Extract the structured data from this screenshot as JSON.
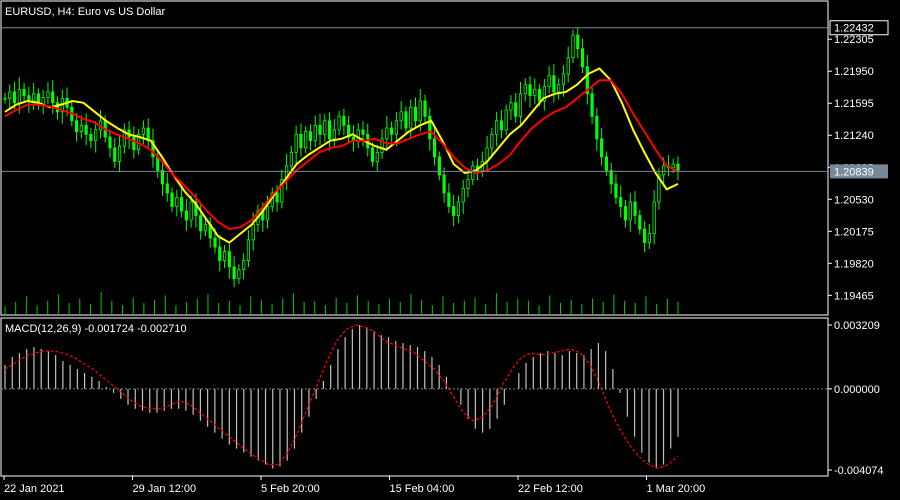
{
  "window": {
    "symbol_title": "EURUSD, H4:  Euro vs US Dollar",
    "macd_title": "MACD(12,26,9) -0.001724 -0.002710"
  },
  "colors": {
    "background": "#000000",
    "candle_bull": "#00ff00",
    "candle_bear": "#00ff00",
    "ma_fast": "#ffff00",
    "ma_slow": "#ff0000",
    "histogram": "#c0c0c0",
    "signal": "#ff0000",
    "grid": "#808080",
    "text": "#ffffff",
    "bid_line": "#778899"
  },
  "chart_data": [
    {
      "type": "candlestick",
      "title": "EURUSD, H4:  Euro vs US Dollar",
      "y_ticks": [
        "1.22305",
        "1.21950",
        "1.21595",
        "1.21240",
        "1.20885",
        "1.20530",
        "1.20175",
        "1.19820",
        "1.19465"
      ],
      "ylim": [
        1.1928,
        1.2254
      ],
      "last_price_label": "1.20839",
      "last_price": 1.20839,
      "top_price_label": "1.22432",
      "top_price": 1.22432,
      "x_ticks": [
        "22 Jan 2021",
        "29 Jan 12:00",
        "5 Feb 20:00",
        "15 Feb 04:00",
        "22 Feb 12:00",
        "1 Mar 20:00"
      ],
      "close_series": [
        1.2165,
        1.2172,
        1.216,
        1.2175,
        1.2168,
        1.2162,
        1.217,
        1.2158,
        1.2166,
        1.2172,
        1.216,
        1.215,
        1.2165,
        1.2155,
        1.214,
        1.2128,
        1.2135,
        1.2125,
        1.2118,
        1.213,
        1.214,
        1.2122,
        1.211,
        1.2095,
        1.2112,
        1.213,
        1.2122,
        1.2108,
        1.2125,
        1.2132,
        1.2118,
        1.21,
        1.2085,
        1.207,
        1.206,
        1.2045,
        1.2055,
        1.204,
        1.203,
        1.205,
        1.2035,
        1.2018,
        1.2025,
        1.201,
        1.2,
        1.1985,
        1.1995,
        1.1978,
        1.1965,
        1.1975,
        1.1985,
        1.2008,
        1.2025,
        1.204,
        1.203,
        1.2045,
        1.206,
        1.205,
        1.2075,
        1.209,
        1.2105,
        1.2125,
        1.211,
        1.2128,
        1.2118,
        1.2135,
        1.2125,
        1.214,
        1.212,
        1.213,
        1.2145,
        1.2135,
        1.2122,
        1.2118,
        1.213,
        1.2125,
        1.211,
        1.2095,
        1.2105,
        1.212,
        1.2132,
        1.2125,
        1.214,
        1.215,
        1.2132,
        1.2155,
        1.214,
        1.2162,
        1.2145,
        1.212,
        1.21,
        1.208,
        1.206,
        1.2045,
        1.2035,
        1.205,
        1.2065,
        1.2075,
        1.209,
        1.2085,
        1.2095,
        1.211,
        1.2125,
        1.214,
        1.213,
        1.2152,
        1.216,
        1.2145,
        1.217,
        1.218,
        1.2168,
        1.2175,
        1.2162,
        1.2178,
        1.219,
        1.2172,
        1.218,
        1.2192,
        1.221,
        1.2235,
        1.222,
        1.22,
        1.217,
        1.2145,
        1.212,
        1.21,
        1.2085,
        1.207,
        1.2055,
        1.2045,
        1.203,
        1.205,
        1.2035,
        1.202,
        1.2005,
        1.2015,
        1.205,
        1.208,
        1.209,
        1.2088,
        1.2092,
        1.2085
      ],
      "series": [
        {
          "name": "",
          "kind": "ma_fast",
          "values": [
            1.215,
            1.2158,
            1.2162,
            1.216,
            1.2155,
            1.2158,
            1.2162,
            1.216,
            1.215,
            1.214,
            1.2132,
            1.2125,
            1.2122,
            1.2118,
            1.21,
            1.208,
            1.2062,
            1.2048,
            1.203,
            1.2012,
            1.2005,
            1.2015,
            1.2025,
            1.204,
            1.2058,
            1.2075,
            1.2092,
            1.2102,
            1.211,
            1.2118,
            1.212,
            1.2125,
            1.2118,
            1.2112,
            1.2108,
            1.2118,
            1.2128,
            1.2135,
            1.214,
            1.2118,
            1.2092,
            1.2082,
            1.2085,
            1.2095,
            1.211,
            1.2125,
            1.2135,
            1.215,
            1.2165,
            1.217,
            1.2172,
            1.218,
            1.2192,
            1.2198,
            1.2185,
            1.216,
            1.213,
            1.2105,
            1.2082,
            1.2064,
            1.207
          ]
        },
        {
          "name": "",
          "kind": "ma_slow",
          "values": [
            1.2145,
            1.2152,
            1.2158,
            1.2158,
            1.2156,
            1.2152,
            1.2148,
            1.2142,
            1.2138,
            1.213,
            1.2125,
            1.212,
            1.2115,
            1.2108,
            1.2095,
            1.208,
            1.2068,
            1.2055,
            1.204,
            1.2028,
            1.202,
            1.2022,
            1.203,
            1.2045,
            1.206,
            1.2072,
            1.2085,
            1.2095,
            1.2105,
            1.211,
            1.2112,
            1.2118,
            1.2118,
            1.212,
            1.2115,
            1.2115,
            1.212,
            1.2125,
            1.2128,
            1.2115,
            1.21,
            1.2088,
            1.2082,
            1.2085,
            1.2092,
            1.2102,
            1.2118,
            1.2132,
            1.2142,
            1.215,
            1.2155,
            1.2165,
            1.2175,
            1.2185,
            1.2185,
            1.217,
            1.2148,
            1.2128,
            1.2108,
            1.209,
            1.2084
          ]
        }
      ],
      "volume_relative": [
        0.35,
        0.55,
        0.8,
        0.4,
        0.6,
        0.9,
        0.5,
        0.7,
        0.45,
        1.0,
        0.6,
        0.4,
        0.75,
        0.5,
        0.65,
        0.85,
        0.4,
        0.55,
        0.7,
        0.9,
        0.5,
        0.6,
        0.4,
        0.8,
        0.65,
        0.45,
        0.7,
        0.95,
        0.55,
        0.6,
        0.4,
        0.75,
        0.5,
        0.85,
        0.6,
        0.45,
        0.7,
        0.55,
        0.9,
        0.65,
        0.4,
        0.8,
        0.5,
        0.6,
        0.75,
        0.45,
        0.95,
        0.55,
        0.7,
        0.6,
        0.4,
        0.85,
        0.5,
        0.65,
        0.45,
        0.7,
        0.55,
        0.9,
        0.6,
        0.5,
        0.8,
        0.45,
        0.7,
        0.55
      ]
    },
    {
      "type": "histogram",
      "title": "MACD(12,26,9) -0.001724 -0.002710",
      "y_ticks": [
        "0.003209",
        "0.000000",
        "-0.004074"
      ],
      "ylim": [
        -0.004074,
        0.003209
      ],
      "zero_label": "0.000000",
      "histogram": [
        0.0012,
        0.0016,
        0.0018,
        0.002,
        0.0021,
        0.002,
        0.0019,
        0.0017,
        0.0014,
        0.0012,
        0.001,
        0.0008,
        0.0006,
        0.0004,
        0.0001,
        -0.0002,
        -0.0005,
        -0.0008,
        -0.001,
        -0.0011,
        -0.0012,
        -0.0012,
        -0.0011,
        -0.001,
        -0.001,
        -0.0011,
        -0.0013,
        -0.0016,
        -0.0019,
        -0.0022,
        -0.0025,
        -0.0028,
        -0.003,
        -0.0032,
        -0.0034,
        -0.0036,
        -0.0038,
        -0.004,
        -0.0039,
        -0.0036,
        -0.003,
        -0.0022,
        -0.0014,
        -0.0005,
        0.0004,
        0.0012,
        0.002,
        0.0026,
        0.003,
        0.0032,
        0.0031,
        0.0029,
        0.0027,
        0.0026,
        0.0024,
        0.0023,
        0.0022,
        0.0021,
        0.0019,
        0.0016,
        0.0012,
        0.0006,
        0.0,
        -0.0008,
        -0.0015,
        -0.002,
        -0.0022,
        -0.002,
        -0.0015,
        -0.0008,
        0.0,
        0.0008,
        0.0013,
        0.0016,
        0.0018,
        0.0019,
        0.0018,
        0.0017,
        0.0019,
        0.0018,
        0.0017,
        0.002,
        0.0023,
        0.0019,
        0.001,
        -0.0002,
        -0.0014,
        -0.0024,
        -0.0032,
        -0.0037,
        -0.004,
        -0.0038,
        -0.003,
        -0.0024
      ],
      "signal": [
        0.001,
        0.0013,
        0.0016,
        0.0018,
        0.0019,
        0.0019,
        0.0018,
        0.0016,
        0.0013,
        0.001,
        0.0006,
        0.0002,
        -0.0002,
        -0.0006,
        -0.0009,
        -0.001,
        -0.001,
        -0.0008,
        -0.0006,
        -0.0008,
        -0.0012,
        -0.0016,
        -0.002,
        -0.0024,
        -0.0028,
        -0.0032,
        -0.0035,
        -0.0038,
        -0.0038,
        -0.0032,
        -0.0022,
        -0.001,
        0.0002,
        0.0014,
        0.0024,
        0.003,
        0.0032,
        0.0031,
        0.0028,
        0.0024,
        0.0022,
        0.002,
        0.0018,
        0.0014,
        0.001,
        0.0004,
        -0.0004,
        -0.0012,
        -0.0016,
        -0.0014,
        -0.0008,
        0.0002,
        0.001,
        0.0016,
        0.0018,
        0.0017,
        0.0018,
        0.0019,
        0.002,
        0.0018,
        0.0012,
        0.0002,
        -0.001,
        -0.002,
        -0.0028,
        -0.0034,
        -0.0038,
        -0.004,
        -0.0038,
        -0.0034
      ]
    }
  ]
}
